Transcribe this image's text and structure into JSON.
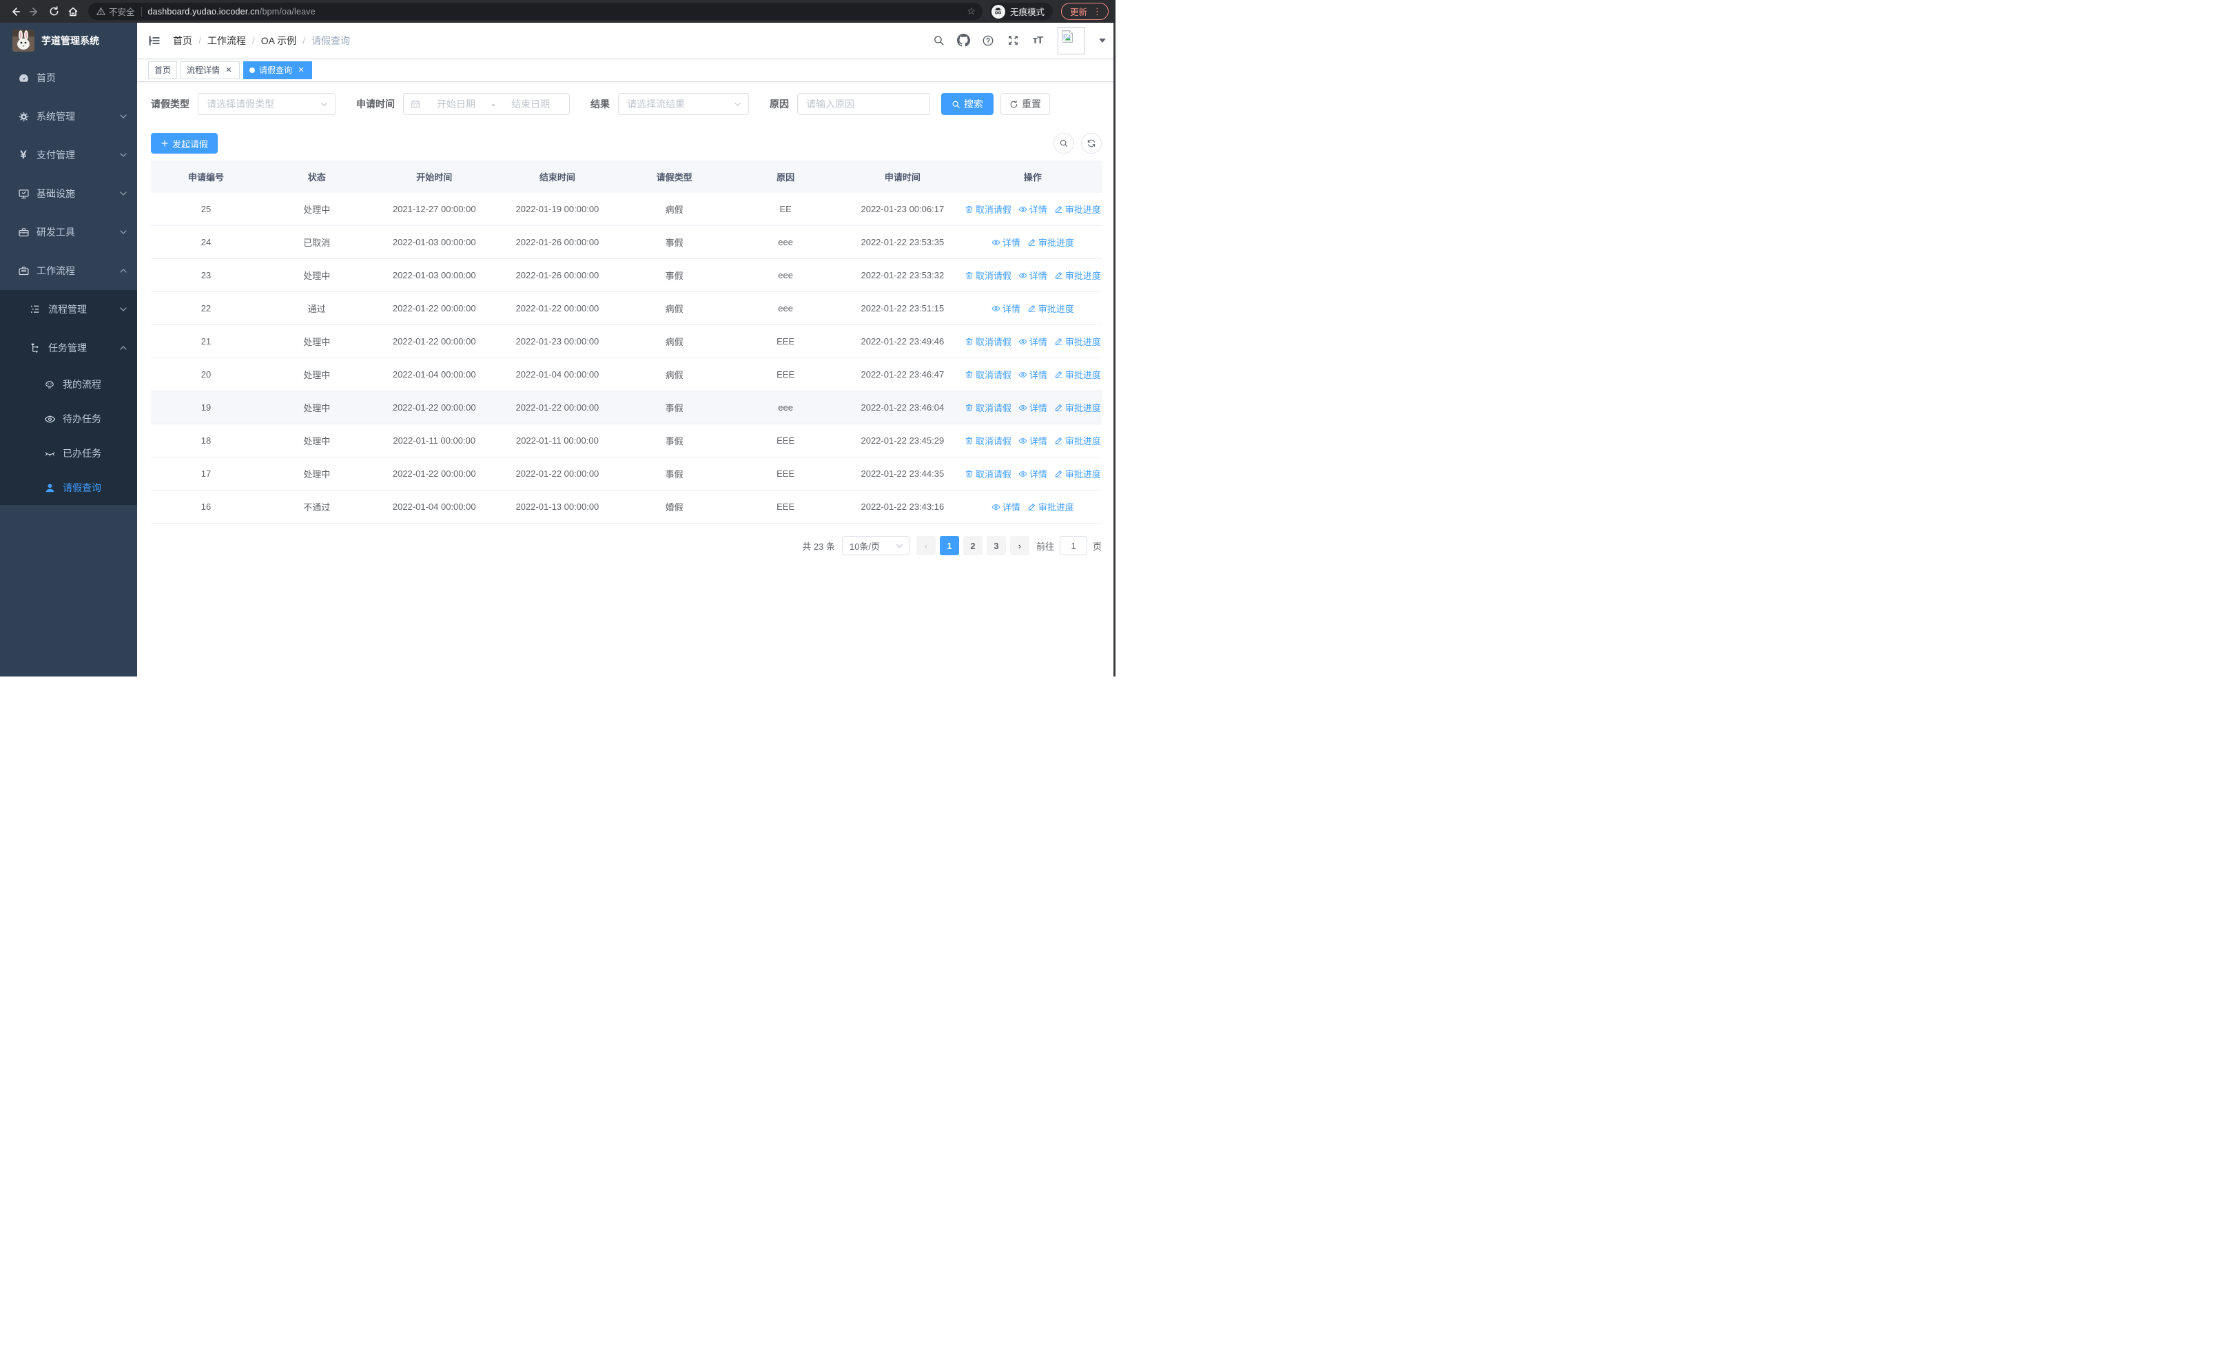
{
  "browser": {
    "security_label": "不安全",
    "url_host": "dashboard.yudao.iocoder.cn",
    "url_path": "/bpm/oa/leave",
    "incognito_label": "无痕模式",
    "update_label": "更新"
  },
  "sidebar": {
    "app_title": "芋道管理系统",
    "items": [
      {
        "label": "首页"
      },
      {
        "label": "系统管理"
      },
      {
        "label": "支付管理"
      },
      {
        "label": "基础设施"
      },
      {
        "label": "研发工具"
      },
      {
        "label": "工作流程"
      }
    ],
    "workflow_children": [
      {
        "label": "流程管理"
      },
      {
        "label": "任务管理"
      }
    ],
    "task_children": [
      {
        "label": "我的流程"
      },
      {
        "label": "待办任务"
      },
      {
        "label": "已办任务"
      },
      {
        "label": "请假查询"
      }
    ]
  },
  "header": {
    "breadcrumb": [
      "首页",
      "工作流程",
      "OA 示例",
      "请假查询"
    ]
  },
  "tabs": [
    {
      "label": "首页"
    },
    {
      "label": "流程详情"
    },
    {
      "label": "请假查询"
    }
  ],
  "filters": {
    "leave_type_label": "请假类型",
    "leave_type_placeholder": "请选择请假类型",
    "apply_time_label": "申请时间",
    "start_placeholder": "开始日期",
    "range_separator": "-",
    "end_placeholder": "结束日期",
    "result_label": "结果",
    "result_placeholder": "请选择流结果",
    "reason_label": "原因",
    "reason_placeholder": "请输入原因",
    "search_label": "搜索",
    "reset_label": "重置"
  },
  "toolbar": {
    "create_label": "发起请假"
  },
  "table": {
    "columns": [
      "申请编号",
      "状态",
      "开始时间",
      "结束时间",
      "请假类型",
      "原因",
      "申请时间",
      "操作"
    ],
    "action_labels": {
      "cancel": "取消请假",
      "detail": "详情",
      "progress": "审批进度"
    },
    "rows": [
      {
        "id": "25",
        "status": "处理中",
        "start": "2021-12-27 00:00:00",
        "end": "2022-01-19 00:00:00",
        "type": "病假",
        "reason": "EE",
        "apply_time": "2022-01-23 00:06:17",
        "actions": [
          "cancel",
          "detail",
          "progress"
        ]
      },
      {
        "id": "24",
        "status": "已取消",
        "start": "2022-01-03 00:00:00",
        "end": "2022-01-26 00:00:00",
        "type": "事假",
        "reason": "eee",
        "apply_time": "2022-01-22 23:53:35",
        "actions": [
          "detail",
          "progress"
        ]
      },
      {
        "id": "23",
        "status": "处理中",
        "start": "2022-01-03 00:00:00",
        "end": "2022-01-26 00:00:00",
        "type": "事假",
        "reason": "eee",
        "apply_time": "2022-01-22 23:53:32",
        "actions": [
          "cancel",
          "detail",
          "progress"
        ]
      },
      {
        "id": "22",
        "status": "通过",
        "start": "2022-01-22 00:00:00",
        "end": "2022-01-22 00:00:00",
        "type": "病假",
        "reason": "eee",
        "apply_time": "2022-01-22 23:51:15",
        "actions": [
          "detail",
          "progress"
        ]
      },
      {
        "id": "21",
        "status": "处理中",
        "start": "2022-01-22 00:00:00",
        "end": "2022-01-23 00:00:00",
        "type": "病假",
        "reason": "EEE",
        "apply_time": "2022-01-22 23:49:46",
        "actions": [
          "cancel",
          "detail",
          "progress"
        ]
      },
      {
        "id": "20",
        "status": "处理中",
        "start": "2022-01-04 00:00:00",
        "end": "2022-01-04 00:00:00",
        "type": "病假",
        "reason": "EEE",
        "apply_time": "2022-01-22 23:46:47",
        "actions": [
          "cancel",
          "detail",
          "progress"
        ]
      },
      {
        "id": "19",
        "status": "处理中",
        "start": "2022-01-22 00:00:00",
        "end": "2022-01-22 00:00:00",
        "type": "事假",
        "reason": "eee",
        "apply_time": "2022-01-22 23:46:04",
        "actions": [
          "cancel",
          "detail",
          "progress"
        ],
        "hovered": true
      },
      {
        "id": "18",
        "status": "处理中",
        "start": "2022-01-11 00:00:00",
        "end": "2022-01-11 00:00:00",
        "type": "事假",
        "reason": "EEE",
        "apply_time": "2022-01-22 23:45:29",
        "actions": [
          "cancel",
          "detail",
          "progress"
        ]
      },
      {
        "id": "17",
        "status": "处理中",
        "start": "2022-01-22 00:00:00",
        "end": "2022-01-22 00:00:00",
        "type": "事假",
        "reason": "EEE",
        "apply_time": "2022-01-22 23:44:35",
        "actions": [
          "cancel",
          "detail",
          "progress"
        ]
      },
      {
        "id": "16",
        "status": "不通过",
        "start": "2022-01-04 00:00:00",
        "end": "2022-01-13 00:00:00",
        "type": "婚假",
        "reason": "EEE",
        "apply_time": "2022-01-22 23:43:16",
        "actions": [
          "detail",
          "progress"
        ]
      }
    ]
  },
  "pagination": {
    "total_label": "共 23 条",
    "page_size_label": "10条/页",
    "pages": [
      "1",
      "2",
      "3"
    ],
    "goto_label": "前往",
    "goto_value": "1",
    "goto_suffix": "页"
  }
}
